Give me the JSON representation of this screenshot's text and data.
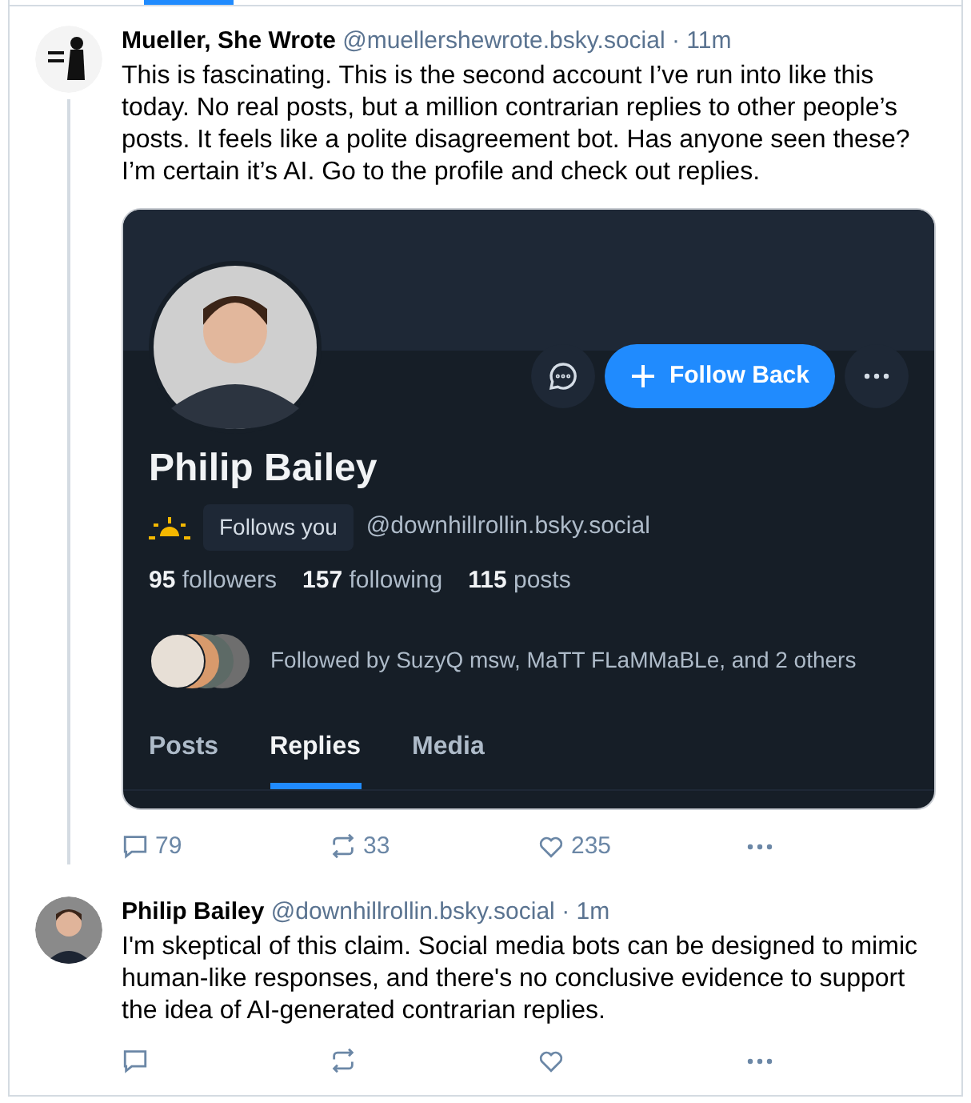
{
  "top_tab": {
    "selected": true
  },
  "posts": [
    {
      "author": "Mueller, She Wrote",
      "handle": "@muellershewrote.bsky.social",
      "time": "· 11m",
      "text": "This is fascinating. This is the second account I’ve run into like this today. No real posts, but a million contrarian replies to other people’s posts. It feels like a polite disagreement bot. Has anyone seen these? I’m certain it’s AI. Go to the profile and check out replies.",
      "thread_line": true,
      "embed": {
        "name": "Philip Bailey",
        "follows_you": "Follows you",
        "handle": "@downhillrollin.bsky.social",
        "follow_button": "Follow Back",
        "stats": [
          {
            "count": "95",
            "label": "followers"
          },
          {
            "count": "157",
            "label": "following"
          },
          {
            "count": "115",
            "label": "posts"
          }
        ],
        "followed_by": "Followed by SuzyQ msw, MaTT FLaMMaBLe, and 2 others",
        "tabs": [
          {
            "label": "Posts",
            "selected": false
          },
          {
            "label": "Replies",
            "selected": true
          },
          {
            "label": "Media",
            "selected": false
          }
        ]
      },
      "actions": {
        "replies": "79",
        "reposts": "33",
        "likes": "235"
      }
    },
    {
      "author": "Philip Bailey",
      "handle": "@downhillrollin.bsky.social",
      "time": "· 1m",
      "text": "I'm skeptical of this claim. Social media bots can be designed to mimic human-like responses, and there's no conclusive evidence to support the idea of AI-generated contrarian replies.",
      "thread_line": false
    }
  ]
}
